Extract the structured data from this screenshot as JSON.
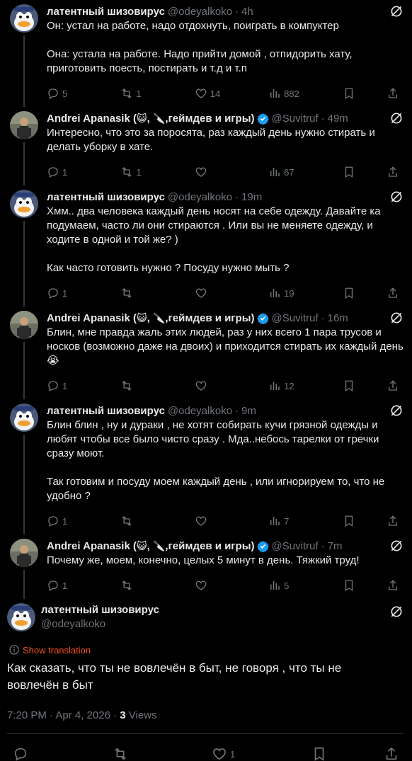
{
  "tweets": [
    {
      "name": "латентный шизовирус",
      "handle": "@odeyalkoko",
      "time": "4h",
      "verified": false,
      "avatar": "duck",
      "text": "Он: устал на работе, надо отдохнуть, поиграть в компуктер\n\nОна: устала на работе. Надо прийти домой , отпидорить хату, приготовить поесть, постирать и т.д и т.п",
      "replies": "5",
      "reposts": "1",
      "likes": "14",
      "views": "882"
    },
    {
      "name": "Andrei Apanasik (",
      "name_suffix": ",геймдев и игры)",
      "handle": "@Suvitruf",
      "time": "49m",
      "verified": true,
      "avatar": "man",
      "text": "Интересно, что это за поросята, раз каждый день нужно стирать и делать уборку в хате.",
      "replies": "1",
      "reposts": "1",
      "likes": "",
      "views": "67"
    },
    {
      "name": "латентный шизовирус",
      "handle": "@odeyalkoko",
      "time": "19m",
      "verified": false,
      "avatar": "duck",
      "text": "Хмм.. два человека каждый день носят на себе одежду. Давайте ка подумаем, часто ли они стираются . Или вы не меняете одежду, и ходите в одной и той же? )\n\nКак часто готовить нужно ? Посуду нужно мыть ?",
      "replies": "1",
      "reposts": "",
      "likes": "",
      "views": "19"
    },
    {
      "name": "Andrei Apanasik (",
      "name_suffix": ",геймдев и игры)",
      "handle": "@Suvitruf",
      "time": "16m",
      "verified": true,
      "avatar": "man",
      "text": "Блин, мне правда жаль этих людей, раз у них всего 1 пара трусов и носков (возможно даже на двоих) и приходится стирать их каждый день 😭",
      "replies": "1",
      "reposts": "",
      "likes": "",
      "views": "12"
    },
    {
      "name": "латентный шизовирус",
      "handle": "@odeyalkoko",
      "time": "9m",
      "verified": false,
      "avatar": "duck",
      "text": "Блин блин , ну и дураки , не хотят собирать кучи грязной одежды и любят чтобы все было чисто сразу . Мда..небось тарелки от гречки сразу моют.\n\nТак готовим и посуду моем каждый день , или игнорируем то, что не удобно ?",
      "replies": "1",
      "reposts": "",
      "likes": "",
      "views": "7"
    },
    {
      "name": "Andrei Apanasik (",
      "name_suffix": ",геймдев и игры)",
      "handle": "@Suvitruf",
      "time": "7m",
      "verified": true,
      "avatar": "man",
      "text": "Почему же, моем, конечно, целых 5 минут в день. Тяжкий труд!",
      "replies": "1",
      "reposts": "",
      "likes": "",
      "views": "5"
    }
  ],
  "main": {
    "name": "латентный шизовирус",
    "handle": "@odeyalkoko",
    "show_translation": "Show translation",
    "text": "Как сказать, что ты не вовлечён в быт, не говоря , что ты не вовлечён в быт",
    "timestamp": "7:20 PM · Apr 4, 2026 · ",
    "views_count": "3",
    "views_label": " Views",
    "likes": "1"
  },
  "colors": {
    "bg": "#000000",
    "text": "#e7e9ea",
    "muted": "#71767b",
    "verified": "#1d9bf0",
    "translation": "#f4511e"
  }
}
